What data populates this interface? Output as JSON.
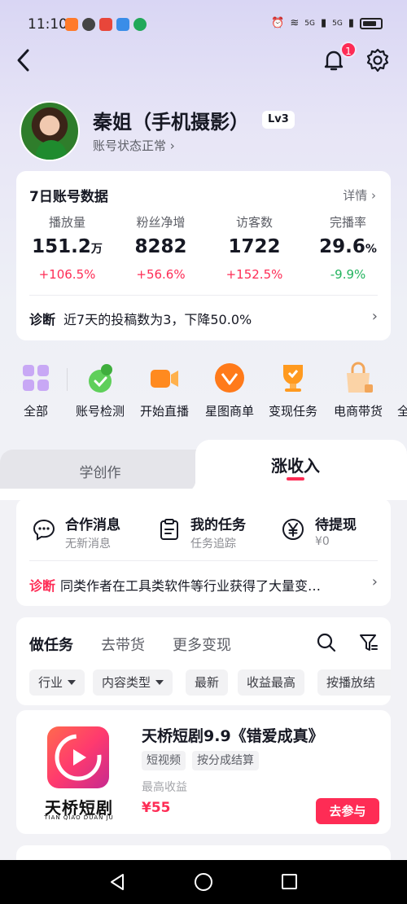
{
  "status_bar": {
    "time": "11:10",
    "net_label_1": "5G",
    "net_label_2": "5G"
  },
  "top_nav": {
    "notification_count": "1"
  },
  "profile": {
    "name": "秦姐（手机摄影）",
    "level": "Lv3",
    "account_status": "账号状态正常 ›"
  },
  "data_card": {
    "title": "7日账号数据",
    "detail": "详情 ›",
    "metrics": [
      {
        "label": "播放量",
        "value": "151.2",
        "unit": "万",
        "change": "+106.5%",
        "trend": "up"
      },
      {
        "label": "粉丝净增",
        "value": "8282",
        "unit": "",
        "change": "+56.6%",
        "trend": "up"
      },
      {
        "label": "访客数",
        "value": "1722",
        "unit": "",
        "change": "+152.5%",
        "trend": "up"
      },
      {
        "label": "完播率",
        "value": "29.6",
        "unit": "%",
        "change": "-9.9%",
        "trend": "down"
      }
    ],
    "diagnosis_label": "诊断",
    "diagnosis_text": "近7天的投稿数为3，下降50.0%"
  },
  "quick_actions": [
    {
      "label": "全部",
      "icon": "grid-icon"
    },
    {
      "label": "账号检测",
      "icon": "account-check-icon"
    },
    {
      "label": "开始直播",
      "icon": "live-camera-icon"
    },
    {
      "label": "星图商单",
      "icon": "star-map-icon"
    },
    {
      "label": "变现任务",
      "icon": "trophy-icon"
    },
    {
      "label": "电商带货",
      "icon": "shopping-bag-icon"
    },
    {
      "label": "全",
      "icon": "more-icon"
    }
  ],
  "tabs": {
    "left": "学创作",
    "right": "涨收入"
  },
  "income": {
    "items": [
      {
        "title": "合作消息",
        "sub": "无新消息",
        "icon": "chat-bubble-icon"
      },
      {
        "title": "我的任务",
        "sub": "任务追踪",
        "icon": "clipboard-icon"
      },
      {
        "title": "待提现",
        "sub": "¥0",
        "icon": "yen-coin-icon"
      }
    ],
    "diagnosis_label": "诊断",
    "diagnosis_text": "同类作者在工具类软件等行业获得了大量变…"
  },
  "tasks": {
    "tabs": [
      "做任务",
      "去带货",
      "更多变现"
    ],
    "filters": [
      {
        "label": "行业",
        "dropdown": true
      },
      {
        "label": "内容类型",
        "dropdown": true
      },
      {
        "label": "最新",
        "dropdown": false
      },
      {
        "label": "收益最高",
        "dropdown": false
      },
      {
        "label": "按播放结",
        "dropdown": false
      }
    ]
  },
  "product": {
    "logo_text": "天桥短剧",
    "logo_sub": "TIAN QIAO DUAN JU",
    "title": "天桥短剧9.9《错爱成真》",
    "tags": [
      "短视频",
      "按分成结算"
    ],
    "max_label": "最高收益",
    "price": "¥55",
    "join_label": "去参与"
  },
  "colors": {
    "accent": "#fe2c55",
    "up": "#fe2c55",
    "down": "#22b35e"
  }
}
